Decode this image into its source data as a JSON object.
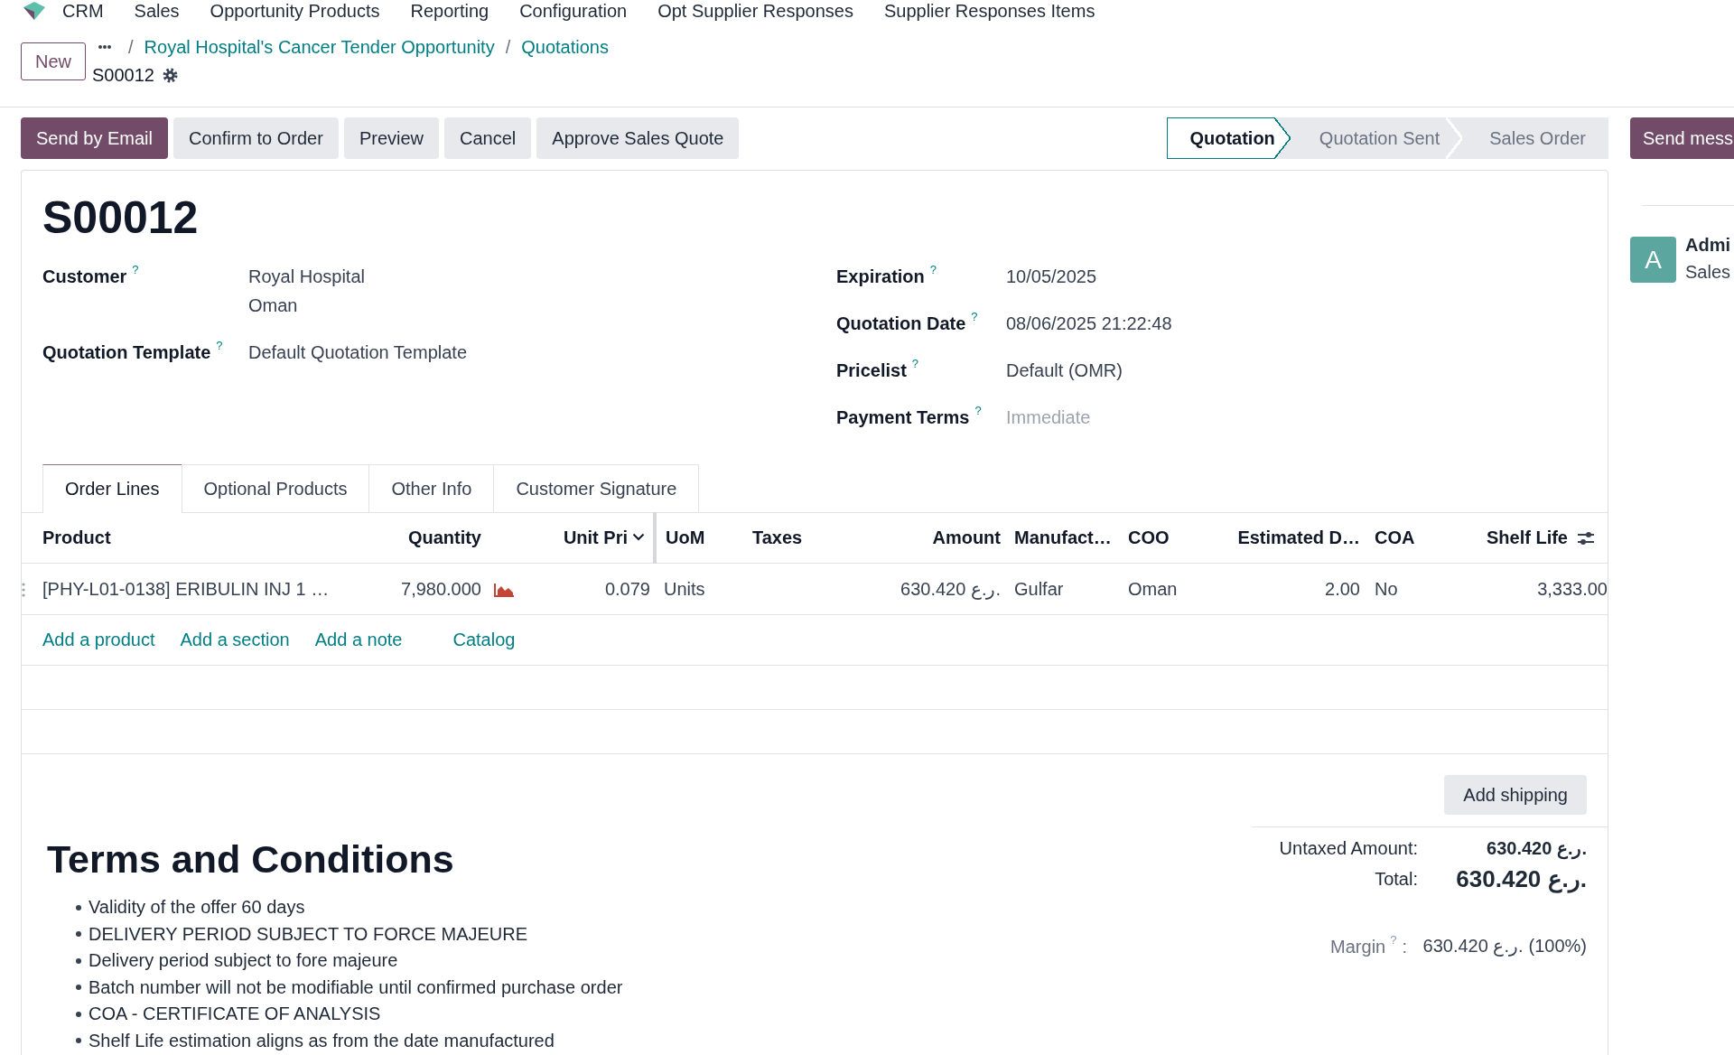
{
  "navbar": {
    "app": "CRM",
    "menu": [
      "Sales",
      "Opportunity Products",
      "Reporting",
      "Configuration",
      "Opt Supplier Responses",
      "Supplier Responses Items"
    ]
  },
  "control_panel": {
    "new_button": "New",
    "breadcrumbs": [
      {
        "separator": "/",
        "label": "Royal Hospital's Cancer Tender Opportunity"
      },
      {
        "separator": "/",
        "label": "Quotations"
      }
    ],
    "record": "S00012"
  },
  "actions": [
    {
      "label": "Send by Email",
      "kind": "primary"
    },
    {
      "label": "Confirm to Order",
      "kind": "secondary"
    },
    {
      "label": "Preview",
      "kind": "secondary"
    },
    {
      "label": "Cancel",
      "kind": "secondary"
    },
    {
      "label": "Approve Sales Quote",
      "kind": "secondary"
    }
  ],
  "statusbar": [
    {
      "label": "Quotation",
      "selected": true
    },
    {
      "label": "Quotation Sent",
      "selected": false
    },
    {
      "label": "Sales Order",
      "selected": false
    }
  ],
  "sheet": {
    "title": "S00012",
    "left_fields": [
      {
        "label": "Customer",
        "help": "?",
        "lines": [
          "Royal Hospital",
          "Oman"
        ]
      },
      {
        "label": "Quotation Template",
        "help": "?",
        "lines": [
          "Default Quotation Template"
        ]
      }
    ],
    "right_fields": [
      {
        "label": "Expiration",
        "help": "?",
        "lines": [
          "10/05/2025"
        ]
      },
      {
        "label": "Quotation Date",
        "help": "?",
        "lines": [
          "08/06/2025 21:22:48"
        ]
      },
      {
        "label": "Pricelist",
        "help": "?",
        "lines": [
          "Default (OMR)"
        ]
      },
      {
        "label": "Payment Terms",
        "help": "?",
        "placeholder": "Immediate"
      }
    ],
    "tabs": [
      {
        "label": "Order Lines",
        "selected": true
      },
      {
        "label": "Optional Products",
        "selected": false
      },
      {
        "label": "Other Info",
        "selected": false
      },
      {
        "label": "Customer Signature",
        "selected": false
      }
    ],
    "table": {
      "columns": [
        {
          "label": "Product",
          "kind": "text"
        },
        {
          "label": "Quantity",
          "kind": "number"
        },
        {
          "label": "Unit Pri",
          "kind": "number"
        },
        {
          "label": "UoM",
          "kind": "text"
        },
        {
          "label": "Taxes",
          "kind": "text"
        },
        {
          "label": "Amount",
          "kind": "number"
        },
        {
          "label": "Manufact…",
          "kind": "text"
        },
        {
          "label": "COO",
          "kind": "text"
        },
        {
          "label": "Estimated D…",
          "kind": "number"
        },
        {
          "label": "COA",
          "kind": "text"
        },
        {
          "label": "Shelf Life",
          "kind": "number"
        }
      ],
      "rows": [
        {
          "product": "[PHY-L01-0138] ERIBULIN INJ 1 …",
          "quantity": "7,980.000",
          "unit_price": "0.079",
          "uom": "Units",
          "amount": "630.420 ر.ع.",
          "manufacturer": "Gulfar",
          "coo": "Oman",
          "estimated_d": "2.00",
          "coa": "No",
          "shelf_life": "3,333.00"
        }
      ],
      "add_links": [
        "Add a product",
        "Add a section",
        "Add a note",
        "Catalog"
      ]
    },
    "add_shipping": "Add shipping",
    "terms": {
      "title": "Terms and Conditions",
      "items": [
        "Validity of the offer 60 days",
        "DELIVERY PERIOD SUBJECT TO FORCE MAJEURE",
        "Delivery period subject to fore majeure",
        "Batch number will not be modifiable until confirmed purchase order",
        "COA - CERTIFICATE OF ANALYSIS",
        "Shelf Life estimation aligns as from the date manufactured"
      ]
    },
    "totals": [
      {
        "kind": "subtotal",
        "label": "Untaxed Amount:",
        "value": "630.420 ر.ع."
      },
      {
        "kind": "total",
        "label": "Total:",
        "value": "630.420 ر.ع."
      },
      {
        "kind": "margin",
        "label": "Margin",
        "help": "?",
        "colon": ":",
        "value": "630.420 ر.ع.",
        "percent": "(100%)"
      }
    ]
  },
  "chatter": {
    "send_button": "Send mess",
    "messages": [
      {
        "avatar": "A",
        "author": "Admi",
        "text": "Sales"
      }
    ]
  }
}
